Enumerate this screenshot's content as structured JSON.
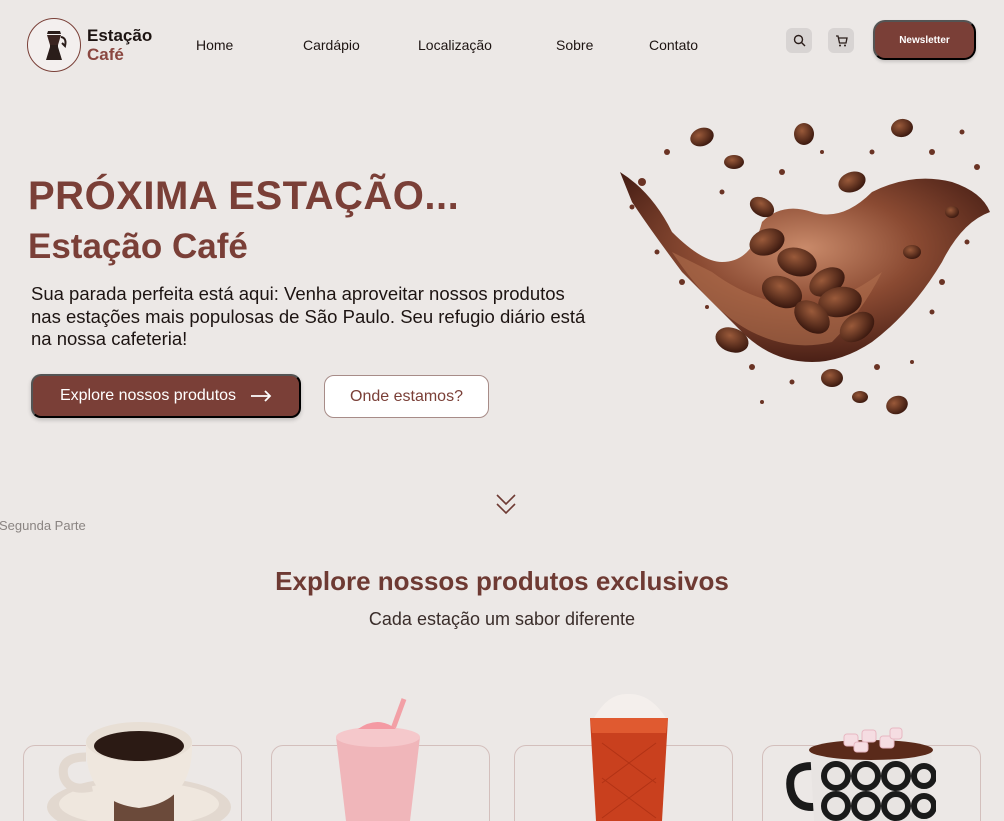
{
  "brand": {
    "name": "Estação",
    "sub": "Café"
  },
  "nav": {
    "items": [
      "Home",
      "Cardápio",
      "Localização",
      "Sobre",
      "Contato"
    ]
  },
  "header": {
    "search_icon": "search-icon",
    "cart_icon": "cart-icon",
    "newsletter_label": "Newsletter"
  },
  "hero": {
    "title": "PRÓXIMA ESTAÇÃO...",
    "subtitle": "Estação Café",
    "description": "Sua parada perfeita está aqui: Venha aproveitar nossos produtos nas estações mais populosas de São Paulo. Seu refugio diário está na nossa cafeteria!",
    "primary_button": "Explore nossos produtos",
    "primary_icon": "arrow-right-icon",
    "secondary_button": "Onde estamos?"
  },
  "scroll_icon": "double-chevron-down-icon",
  "section_tag": "Segunda Parte",
  "products_section": {
    "title": "Explore nossos produtos exclusivos",
    "subtitle": "Cada estação um sabor diferente"
  },
  "colors": {
    "brand": "#7a3f37",
    "background": "#ece8e6"
  }
}
